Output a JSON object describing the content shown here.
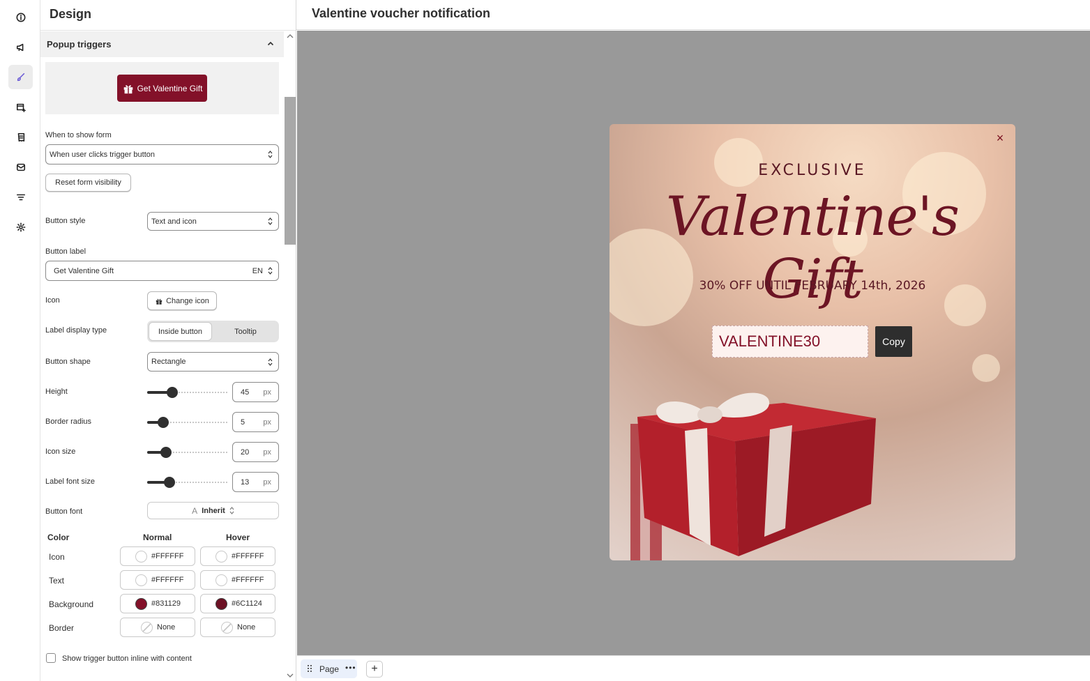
{
  "panel": {
    "title": "Design",
    "section": "Popup triggers",
    "preview_button_label": "Get Valentine Gift",
    "when_to_show_label": "When to show form",
    "when_to_show_value": "When user clicks trigger button",
    "reset_label": "Reset form visibility",
    "button_style_label": "Button style",
    "button_style_value": "Text and icon",
    "button_label_label": "Button label",
    "button_label_value": "Get Valentine Gift",
    "button_label_lang": "EN",
    "icon_label": "Icon",
    "change_icon_label": "Change icon",
    "label_display_label": "Label display type",
    "label_display_options": [
      "Inside button",
      "Tooltip"
    ],
    "button_shape_label": "Button shape",
    "button_shape_value": "Rectangle",
    "sliders": [
      {
        "label": "Height",
        "value": "45",
        "unit": "px",
        "fraction": 0.28
      },
      {
        "label": "Border radius",
        "value": "5",
        "unit": "px",
        "fraction": 0.15
      },
      {
        "label": "Icon size",
        "value": "20",
        "unit": "px",
        "fraction": 0.19
      },
      {
        "label": "Label font size",
        "value": "13",
        "unit": "px",
        "fraction": 0.24
      }
    ],
    "button_font_label": "Button font",
    "button_font_glyph": "A",
    "button_font_value": "Inherit",
    "color_table": {
      "headers": [
        "Color",
        "Normal",
        "Hover"
      ],
      "rows": [
        {
          "label": "Icon",
          "normal": "#FFFFFF",
          "hover": "#FFFFFF"
        },
        {
          "label": "Text",
          "normal": "#FFFFFF",
          "hover": "#FFFFFF"
        },
        {
          "label": "Background",
          "normal": "#831129",
          "hover": "#6C1124"
        },
        {
          "label": "Border",
          "normal": "None",
          "hover": "None"
        }
      ]
    },
    "inline_checkbox_label": "Show trigger button inline with content"
  },
  "main": {
    "title": "Valentine voucher notification",
    "page_tab": "Page",
    "page_tab_more": "•••",
    "add_page": "+"
  },
  "popup": {
    "close": "×",
    "eyebrow": "EXCLUSIVE",
    "headline": "Valentine's Gift",
    "offer": "30% OFF UNTIL FEBRUARY 14th, 2026",
    "code": "VALENTINE30",
    "copy_label": "Copy"
  },
  "colors": {
    "accent": "#831129",
    "accent_hover": "#6C1124",
    "canvas": "#999999"
  }
}
